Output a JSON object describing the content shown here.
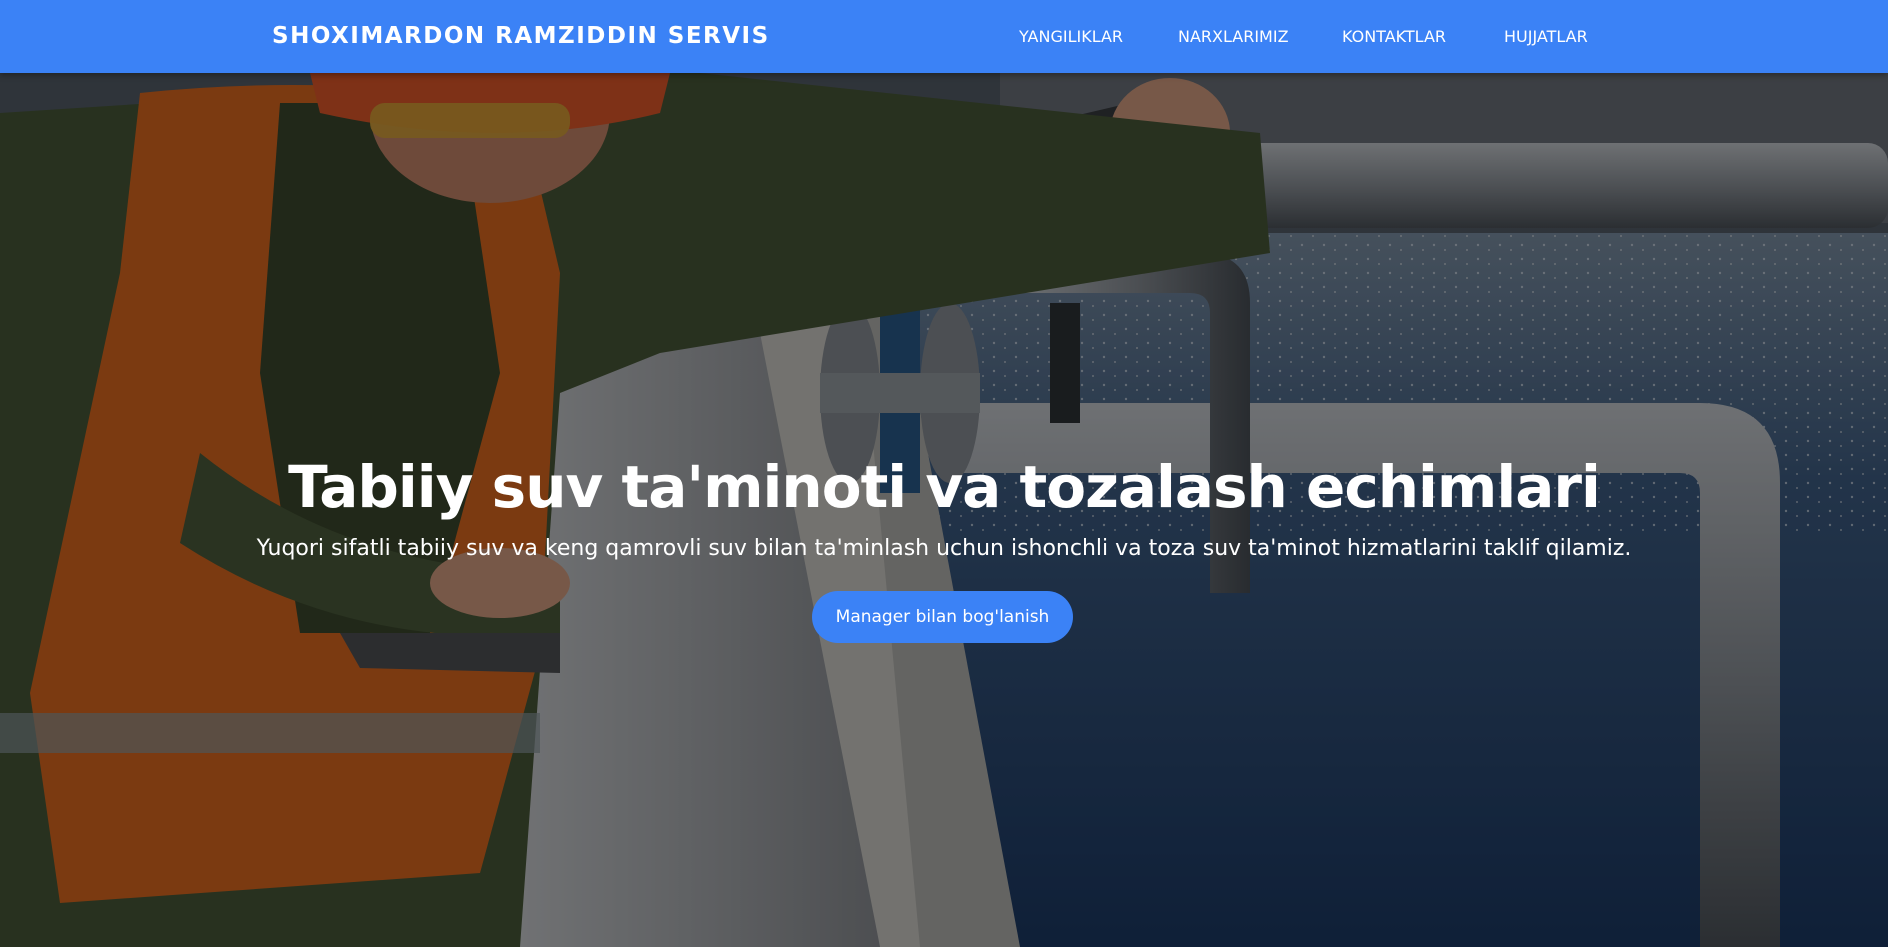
{
  "header": {
    "brand": "SHOXIMARDON RAMZIDDIN SERVIS",
    "nav": [
      {
        "label": "YANGILIKLAR"
      },
      {
        "label": "NARXLARIMIZ"
      },
      {
        "label": "KONTAKTLAR"
      },
      {
        "label": "HUJJATLAR"
      }
    ]
  },
  "hero": {
    "title": "Tabiiy suv ta'minoti va tozalash echimlari",
    "subtitle": "Yuqori sifatli tabiiy suv va keng qamrovli suv bilan ta'minlash uchun ishonchli va toza suv ta'minot hizmatlarini taklif qilamiz.",
    "cta_label": "Manager bilan bog'lanish"
  },
  "colors": {
    "accent": "#3b82f6",
    "text": "#ffffff"
  }
}
